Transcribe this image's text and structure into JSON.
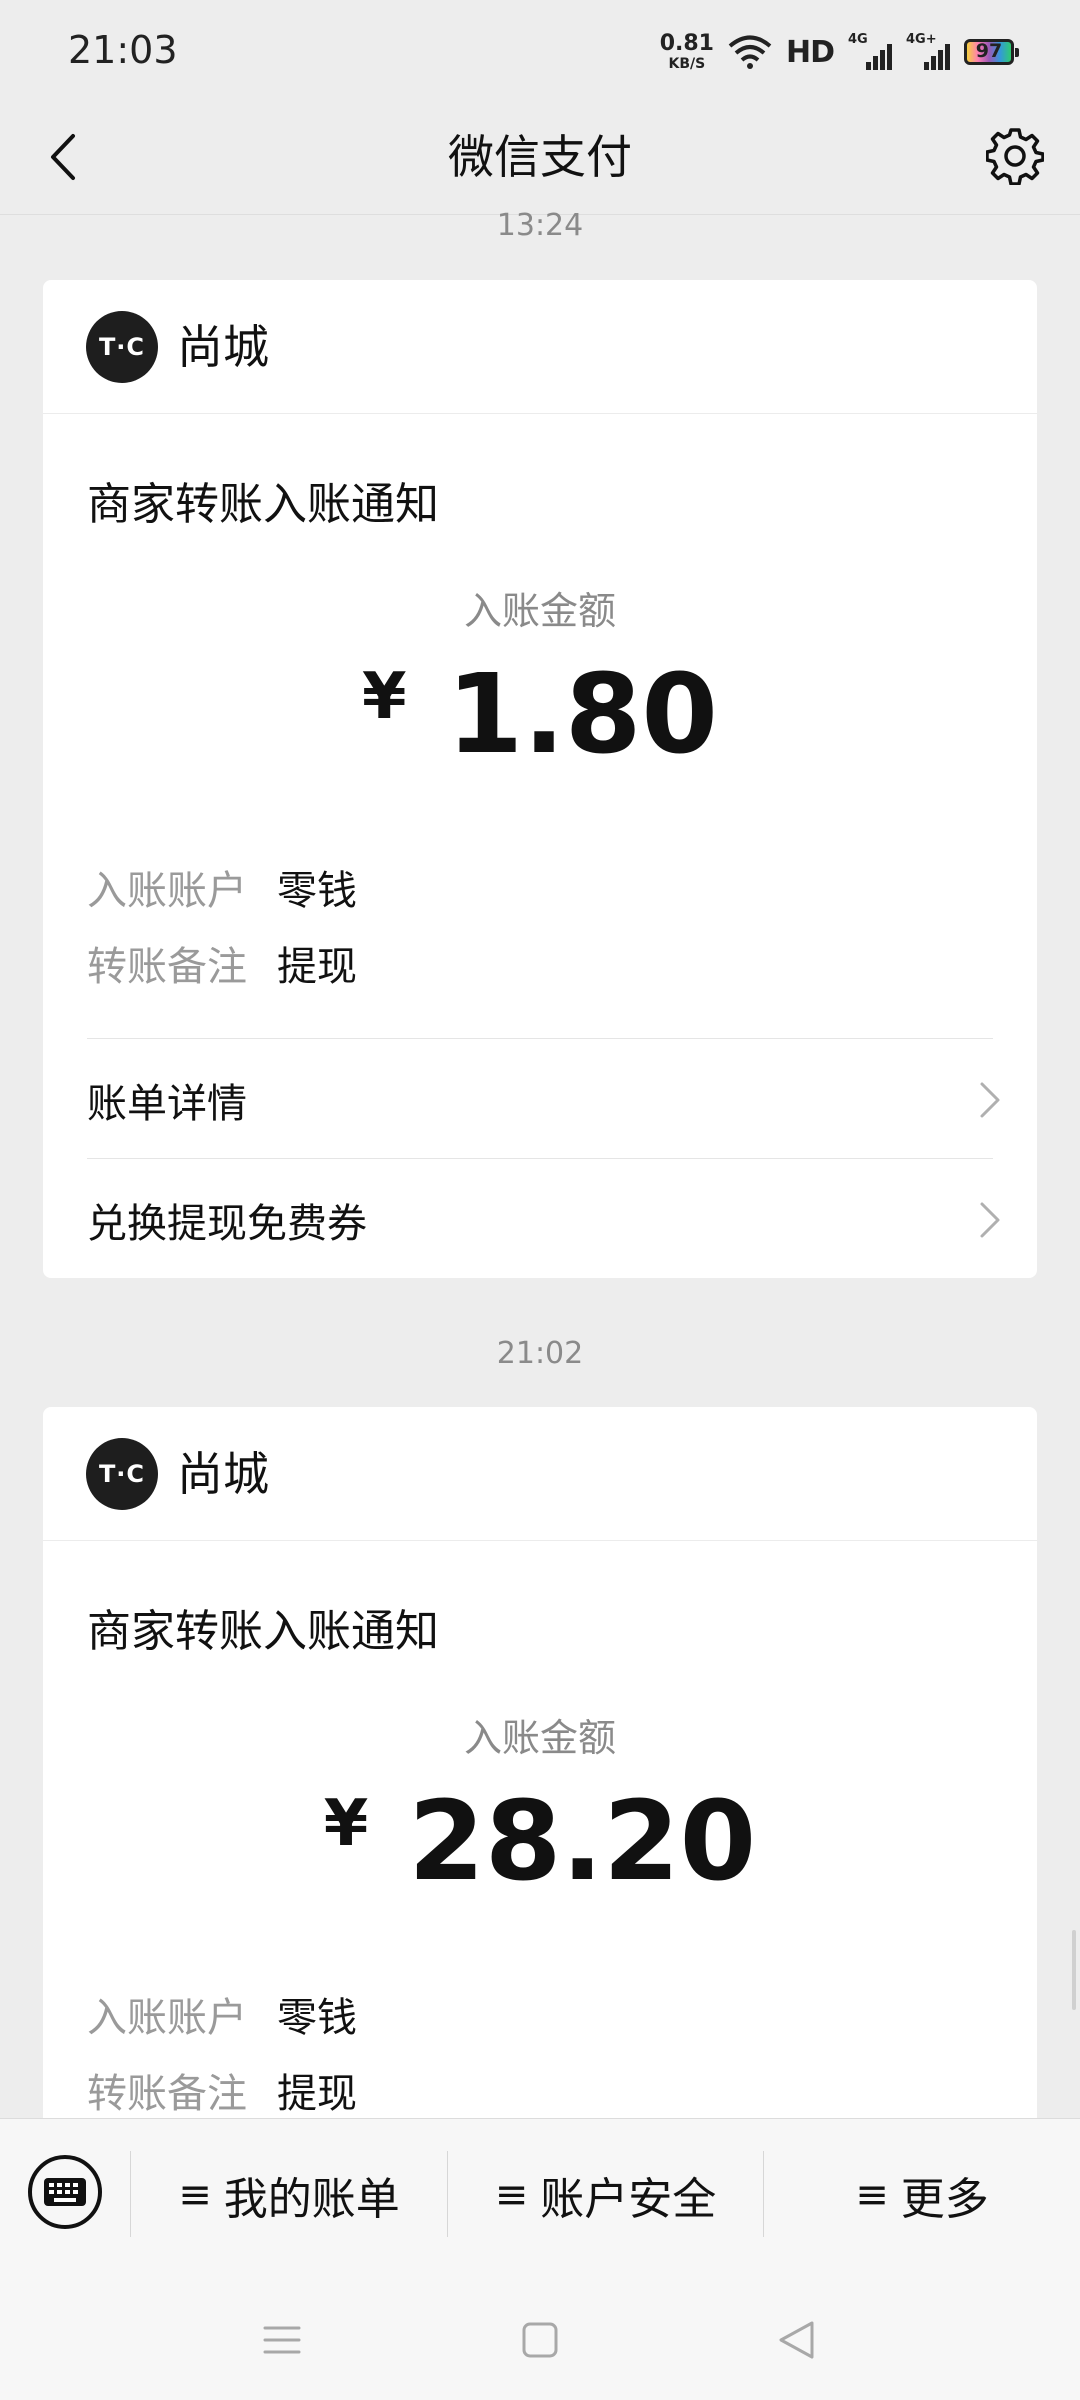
{
  "status_bar": {
    "time": "21:03",
    "net_speed_value": "0.81",
    "net_speed_unit": "KB/S",
    "hd_label": "HD",
    "signal_1_label": "4G",
    "signal_2_label": "4G+",
    "battery_level": "97"
  },
  "header": {
    "title": "微信支付",
    "back_icon": "chevron-left-icon",
    "settings_icon": "gear-icon"
  },
  "messages": [
    {
      "time": "13:24",
      "merchant_logo_text": "T·C",
      "merchant_name": "尚城",
      "notice_title": "商家转账入账通知",
      "amount_label": "入账金额",
      "currency": "¥",
      "amount": "1.80",
      "account_label": "入账账户",
      "account_value": "零钱",
      "remark_label": "转账备注",
      "remark_value": "提现",
      "links": [
        {
          "label": "账单详情"
        },
        {
          "label": "兑换提现免费券"
        }
      ]
    },
    {
      "time": "21:02",
      "merchant_logo_text": "T·C",
      "merchant_name": "尚城",
      "notice_title": "商家转账入账通知",
      "amount_label": "入账金额",
      "currency": "¥",
      "amount": "28.20",
      "account_label": "入账账户",
      "account_value": "零钱",
      "remark_label": "转账备注",
      "remark_value": "提现"
    }
  ],
  "bottom_menu": {
    "keyboard_icon": "keyboard-icon",
    "items": [
      {
        "label": "我的账单"
      },
      {
        "label": "账户安全"
      },
      {
        "label": "更多"
      }
    ]
  },
  "system_nav": {
    "menu_icon": "menu-icon",
    "home_icon": "home-square-icon",
    "back_icon": "back-triangle-icon"
  }
}
